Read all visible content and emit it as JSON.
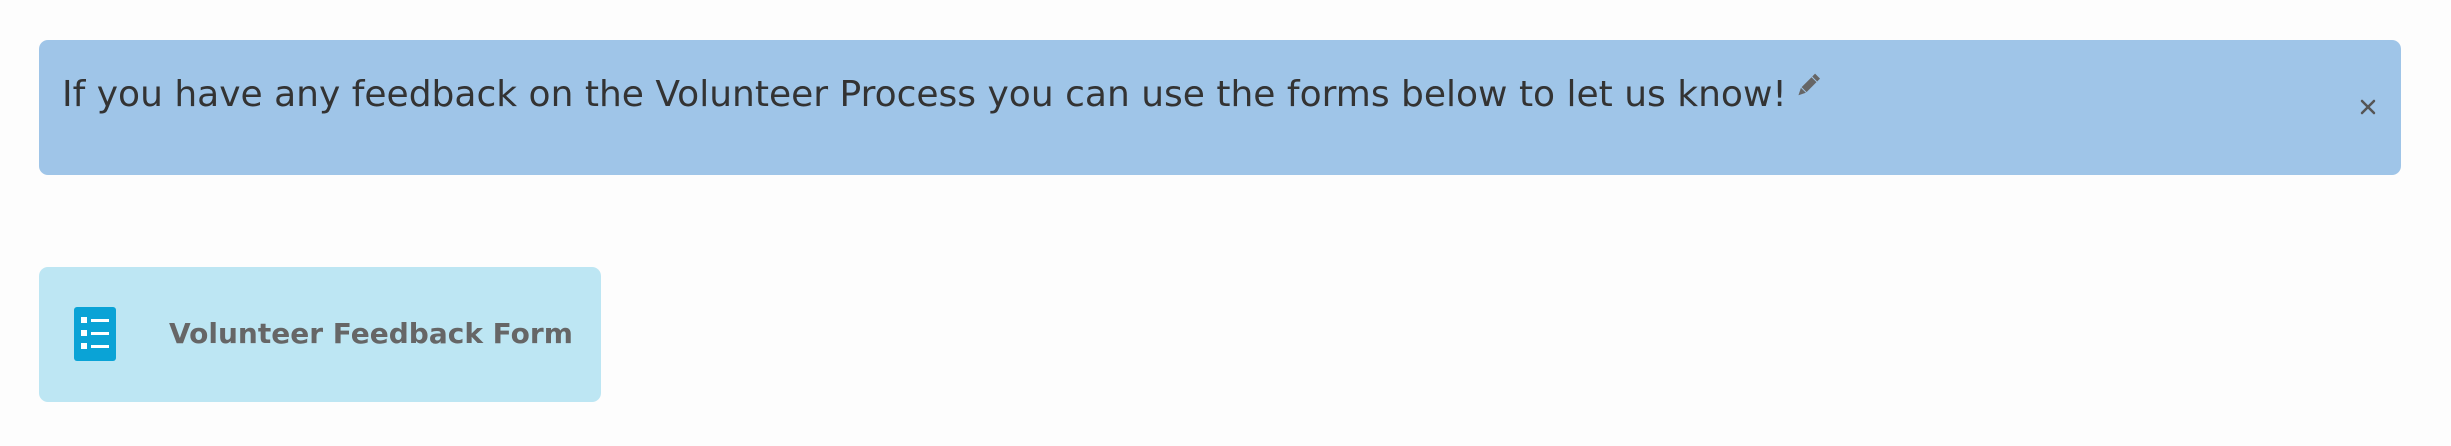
{
  "alert": {
    "message": "If you have any feedback on the Volunteer Process you can use the forms below to let us know!",
    "edit_icon": "pencil-icon",
    "close_icon": "close-icon",
    "background_color": "#9fc5e8"
  },
  "forms": [
    {
      "label": "Volunteer Feedback Form",
      "icon": "list-form-icon",
      "background_color": "#bde6f3",
      "icon_color": "#0aa3d6"
    }
  ]
}
